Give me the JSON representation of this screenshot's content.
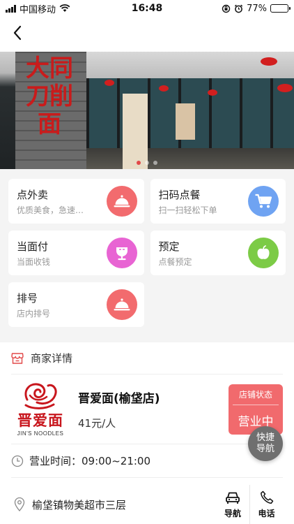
{
  "status_bar": {
    "carrier": "中国移动",
    "time": "16:48",
    "battery": "77%",
    "battery_level": 0.77
  },
  "banner": {
    "sign_text": "大同刀削面",
    "slide_count": 3,
    "active_slide": 0
  },
  "services": [
    {
      "title": "点外卖",
      "subtitle": "优质美食，急速…",
      "icon": "cloche-icon",
      "color": "#f26b6e"
    },
    {
      "title": "扫码点餐",
      "subtitle": "扫一扫轻松下单",
      "icon": "cart-icon",
      "color": "#6fa3f2"
    },
    {
      "title": "当面付",
      "subtitle": "当面收钱",
      "icon": "cup-icon",
      "color": "#e864d3"
    },
    {
      "title": "预定",
      "subtitle": "点餐预定",
      "icon": "apple-icon",
      "color": "#7ccb46"
    },
    {
      "title": "排号",
      "subtitle": "店内排号",
      "icon": "cloche-icon",
      "color": "#f26b6e"
    }
  ],
  "merchant": {
    "section_title": "商家详情",
    "logo_cn": "晋爱面",
    "logo_en": "JIN'S NOODLES",
    "name": "晋爱面(榆垡店)",
    "price": "41元/人",
    "status_label": "店铺状态",
    "status_value": "营业中",
    "hours": "营业时间：09:00~21:00",
    "address": "榆垡镇物美超市三层",
    "nav_label": "导航",
    "phone_label": "电话"
  },
  "quick_nav": {
    "label_1": "快捷",
    "label_2": "导航"
  },
  "colors": {
    "accent": "#f16a6d"
  }
}
